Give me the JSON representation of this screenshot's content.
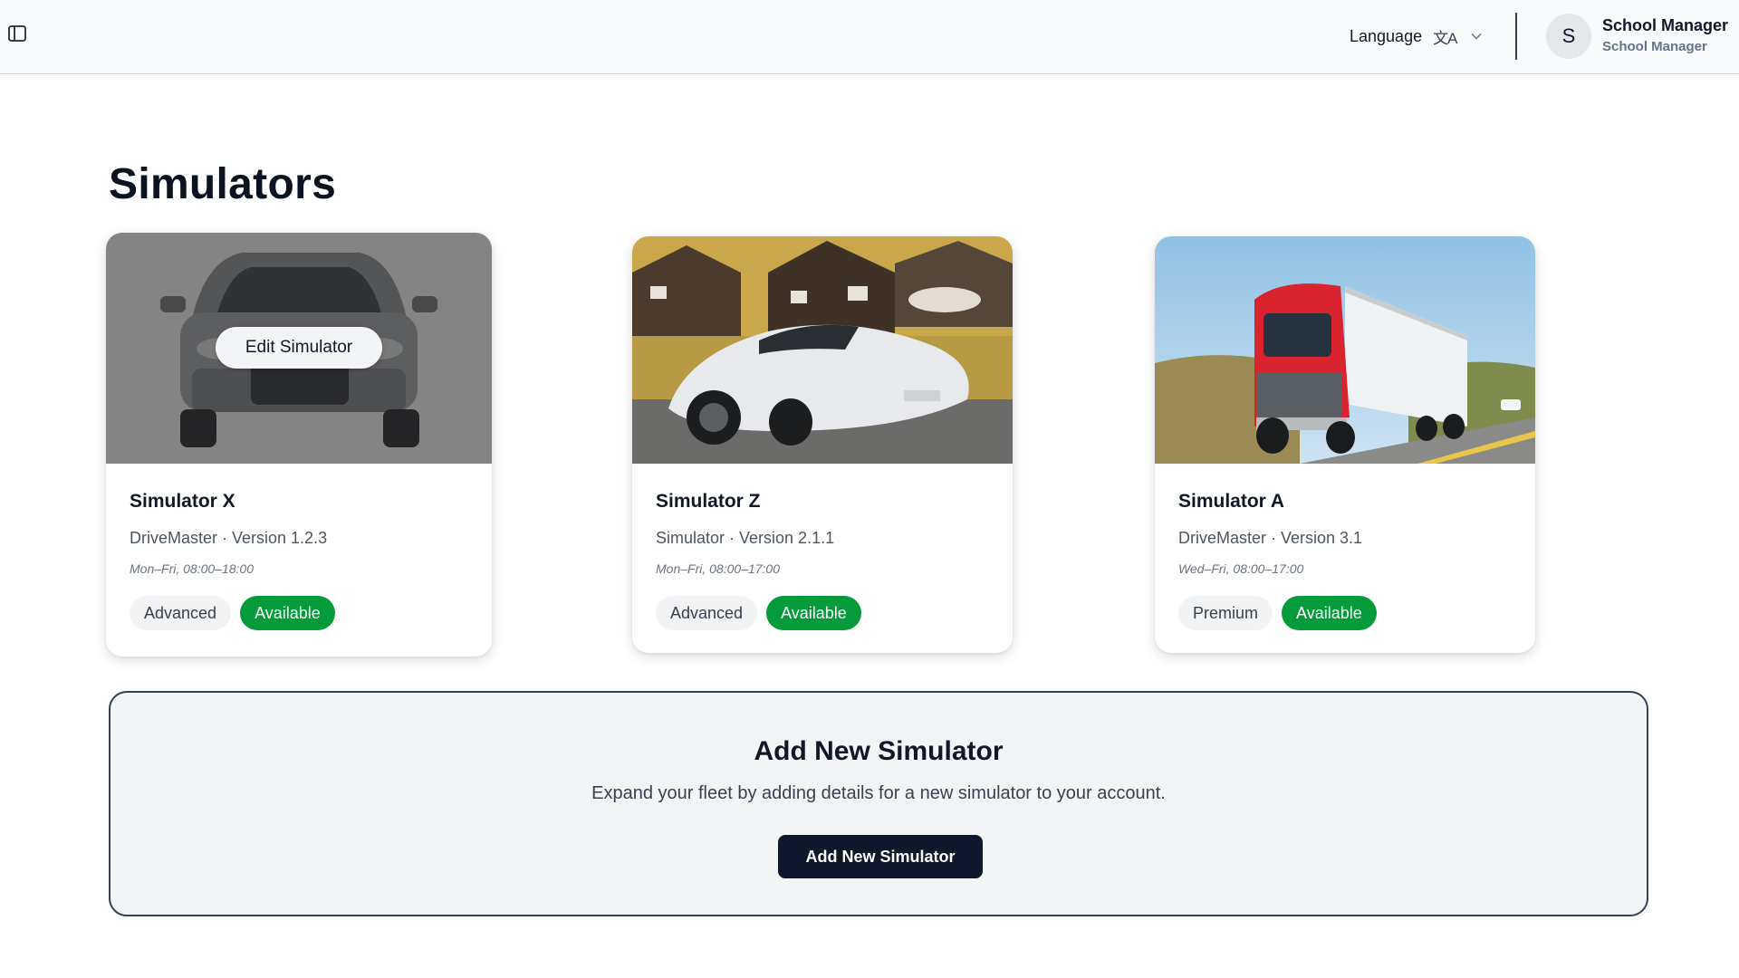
{
  "header": {
    "sidebar_toggle_icon": "sidebar-toggle-icon",
    "language_label": "Language",
    "language_icon": "translate-icon",
    "language_icon_glyph": "文A",
    "user_initial": "S",
    "user_name": "School Manager",
    "user_role": "School Manager"
  },
  "page": {
    "title": "Simulators"
  },
  "cards": [
    {
      "title": "Simulator X",
      "subtitle": "DriveMaster · Version 1.2.3",
      "hours": "Mon–Fri, 08:00–18:00",
      "level": "Advanced",
      "status": "Available",
      "image": "silver-suv-photo",
      "hover_action": "Edit Simulator"
    },
    {
      "title": "Simulator Z",
      "subtitle": "Simulator · Version 2.1.1",
      "hours": "Mon–Fri, 08:00–17:00",
      "level": "Advanced",
      "status": "Available",
      "image": "white-sports-car-photo"
    },
    {
      "title": "Simulator A",
      "subtitle": "DriveMaster · Version 3.1",
      "hours": "Wed–Fri, 08:00–17:00",
      "level": "Premium",
      "status": "Available",
      "image": "red-semi-truck-photo"
    }
  ],
  "add_panel": {
    "title": "Add New Simulator",
    "description": "Expand your fleet by adding details for a new simulator to your account.",
    "button_label": "Add New Simulator"
  },
  "colors": {
    "status_available": "#059b3a",
    "primary_button": "#0f172a"
  }
}
